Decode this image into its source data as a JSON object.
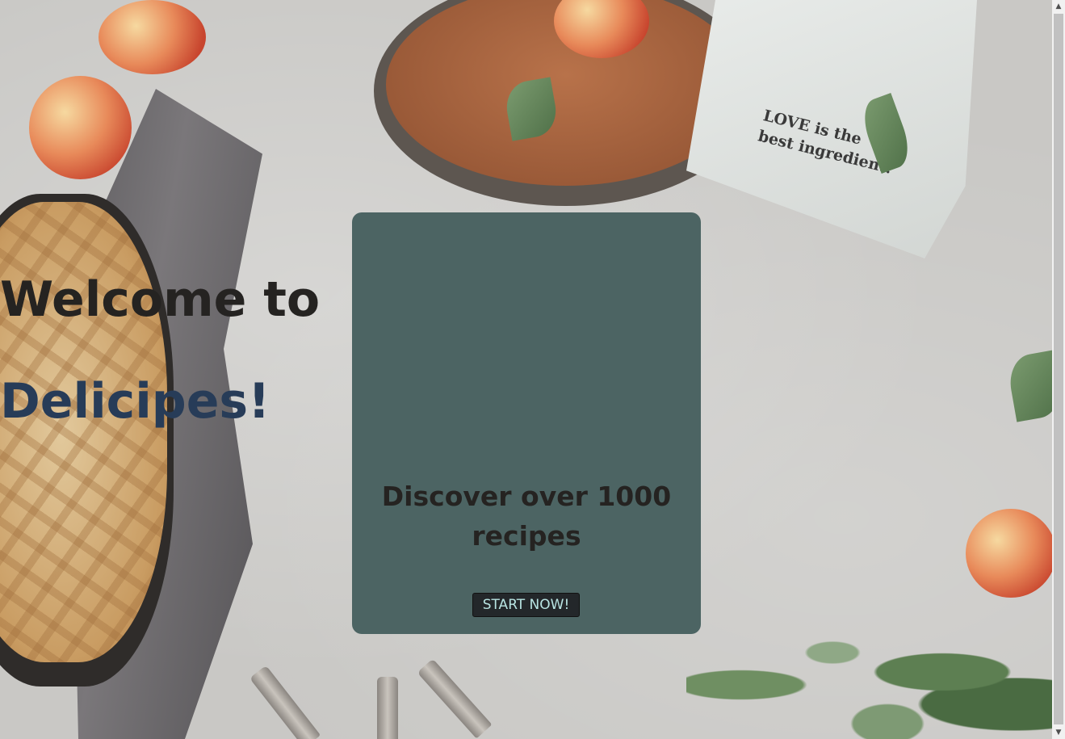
{
  "hero": {
    "heading": "Welcome to",
    "brand": "Delicipes!",
    "subtitle": "Discover over 1000 recipes",
    "cta_label": "START NOW!"
  },
  "background": {
    "napkin_text": "LOVE is the best ingredient."
  },
  "colors": {
    "card_background": "#4c6463",
    "brand_text": "#273c58",
    "cta_background": "#23272a",
    "cta_text": "#b8e4e2"
  },
  "scrollbar": {
    "up_icon": "scroll-up-arrow",
    "down_icon": "scroll-down-arrow"
  }
}
